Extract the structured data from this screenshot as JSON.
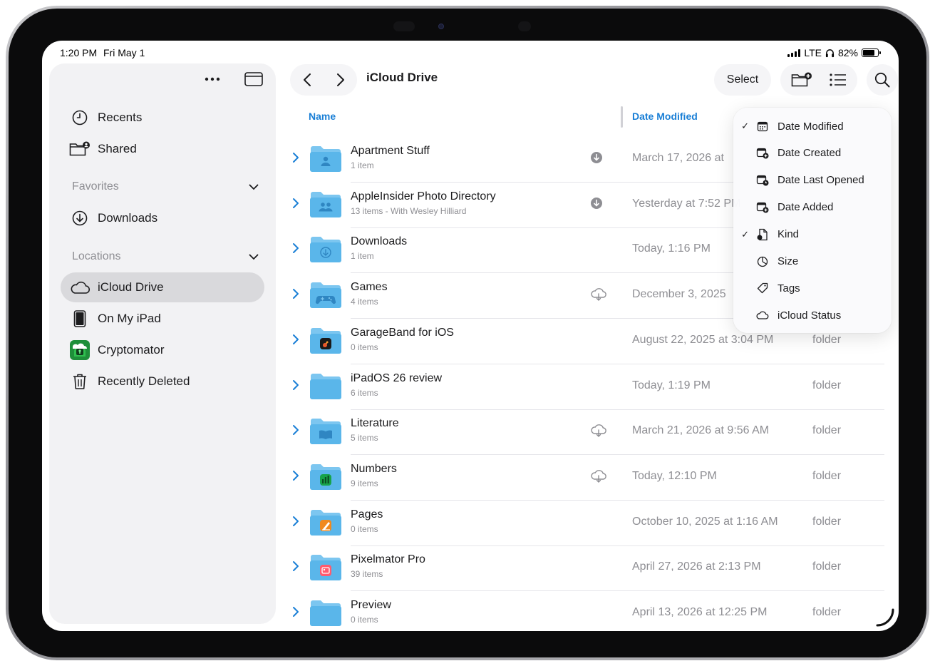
{
  "status_bar": {
    "time": "1:20 PM",
    "date": "Fri May 1",
    "network": "LTE",
    "battery": "82%",
    "battery_level": 0.82
  },
  "sidebar": {
    "items": [
      {
        "label": "Recents",
        "icon": "clock-icon"
      },
      {
        "label": "Shared",
        "icon": "shared-folder-icon"
      }
    ],
    "favorites": {
      "title": "Favorites",
      "items": [
        {
          "label": "Downloads",
          "icon": "download-circle-icon"
        }
      ]
    },
    "locations": {
      "title": "Locations",
      "items": [
        {
          "label": "iCloud Drive",
          "icon": "cloud-icon",
          "selected": true
        },
        {
          "label": "On My iPad",
          "icon": "ipad-icon"
        },
        {
          "label": "Cryptomator",
          "icon": "cryptomator-app-icon"
        },
        {
          "label": "Recently Deleted",
          "icon": "trash-icon"
        }
      ]
    }
  },
  "toolbar": {
    "title": "iCloud Drive",
    "select_label": "Select"
  },
  "columns": {
    "name": "Name",
    "date": "Date Modified"
  },
  "files": [
    {
      "name": "Apartment Stuff",
      "sub": "1 item",
      "date": "March 17, 2026 at",
      "kind": "",
      "status": "download",
      "glyph": "person"
    },
    {
      "name": "AppleInsider Photo Directory",
      "sub": "13 items - With Wesley Hilliard",
      "date": "Yesterday at 7:52 PM",
      "kind": "",
      "status": "download",
      "glyph": "people"
    },
    {
      "name": "Downloads",
      "sub": "1 item",
      "date": "Today, 1:16 PM",
      "kind": "",
      "status": "",
      "glyph": "download"
    },
    {
      "name": "Games",
      "sub": "4 items",
      "date": "December 3, 2025",
      "kind": "",
      "status": "cloud",
      "glyph": "gamepad"
    },
    {
      "name": "GarageBand for iOS",
      "sub": "0 items",
      "date": "August 22, 2025 at 3:04 PM",
      "kind": "folder",
      "status": "",
      "glyph": "garageband"
    },
    {
      "name": "iPadOS 26 review",
      "sub": "6 items",
      "date": "Today, 1:19 PM",
      "kind": "folder",
      "status": "",
      "glyph": ""
    },
    {
      "name": "Literature",
      "sub": "5 items",
      "date": "March 21, 2026 at 9:56 AM",
      "kind": "folder",
      "status": "cloud",
      "glyph": "book"
    },
    {
      "name": "Numbers",
      "sub": "9 items",
      "date": "Today, 12:10 PM",
      "kind": "folder",
      "status": "cloud",
      "glyph": "numbers"
    },
    {
      "name": "Pages",
      "sub": "0 items",
      "date": "October 10, 2025 at 1:16 AM",
      "kind": "folder",
      "status": "",
      "glyph": "pages"
    },
    {
      "name": "Pixelmator Pro",
      "sub": "39 items",
      "date": "April 27, 2026 at 2:13 PM",
      "kind": "folder",
      "status": "",
      "glyph": "pixelmator"
    },
    {
      "name": "Preview",
      "sub": "0 items",
      "date": "April 13, 2026 at 12:25 PM",
      "kind": "folder",
      "status": "",
      "glyph": ""
    }
  ],
  "sort_menu": [
    {
      "label": "Date Modified",
      "checked": true,
      "icon": "calendar-icon"
    },
    {
      "label": "Date Created",
      "checked": false,
      "icon": "calendar-plus-icon"
    },
    {
      "label": "Date Last Opened",
      "checked": false,
      "icon": "calendar-open-icon"
    },
    {
      "label": "Date Added",
      "checked": false,
      "icon": "calendar-add-icon"
    },
    {
      "label": "Kind",
      "checked": true,
      "icon": "doc-kind-icon"
    },
    {
      "label": "Size",
      "checked": false,
      "icon": "size-pie-icon"
    },
    {
      "label": "Tags",
      "checked": false,
      "icon": "tag-icon"
    },
    {
      "label": "iCloud Status",
      "checked": false,
      "icon": "cloud-status-icon"
    }
  ],
  "colors": {
    "accent": "#1a7fd6",
    "folder": "#5ab6ea",
    "folder_tab": "#7cc6f0",
    "selected_bg": "#d9d9dc"
  }
}
